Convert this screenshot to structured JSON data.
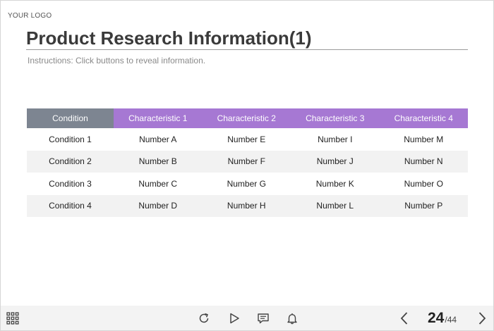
{
  "logo": "YOUR LOGO",
  "title": "Product Research Information(1)",
  "instructions": "Instructions: Click buttons to reveal information.",
  "table": {
    "headers": [
      "Condition",
      "Characteristic 1",
      "Characteristic 2",
      "Characteristic 3",
      "Characteristic 4"
    ],
    "rows": [
      [
        "Condition 1",
        "Number A",
        "Number E",
        "Number I",
        "Number M"
      ],
      [
        "Condition 2",
        "Number B",
        "Number F",
        "Number J",
        "Number N"
      ],
      [
        "Condition 3",
        "Number C",
        "Number G",
        "Number K",
        "Number O"
      ],
      [
        "Condition 4",
        "Number D",
        "Number H",
        "Number L",
        "Number P"
      ]
    ]
  },
  "colors": {
    "header_condition": "#7d8591",
    "header_characteristic": "#a678d3",
    "row_alt": "#f2f2f2"
  },
  "bottombar": {
    "icons": [
      "grid-menu-icon",
      "replay-icon",
      "play-icon",
      "comment-icon",
      "bell-icon",
      "chevron-left-icon",
      "chevron-right-icon"
    ],
    "page_current": "24",
    "page_total": "/44"
  }
}
